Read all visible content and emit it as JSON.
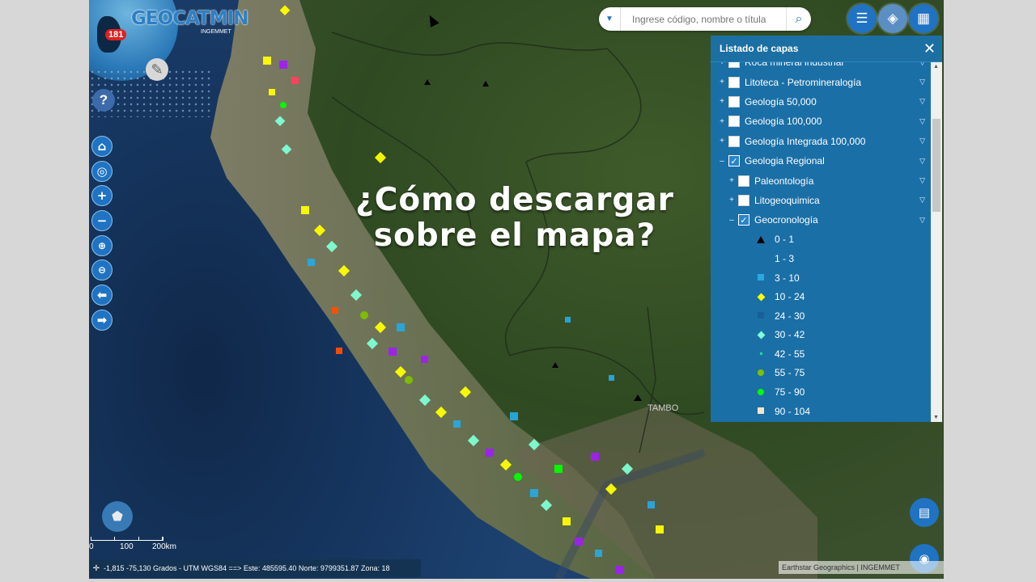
{
  "logo": {
    "text": "GEOCATMIN",
    "sub": "INGEMMET",
    "badge": "181"
  },
  "search": {
    "placeholder": "Ingrese código, nombre o títula"
  },
  "overlay": {
    "line1": "¿Cómo descargar",
    "line2": "sobre el mapa?"
  },
  "layers_panel": {
    "title": "Listado de capas",
    "close_icon": "close-icon",
    "rows": [
      {
        "label": "Roca mineral industrial",
        "expand": "+",
        "checked": false,
        "indent": 0
      },
      {
        "label": "Litoteca - Petromineralogía",
        "expand": "+",
        "checked": false,
        "indent": 0
      },
      {
        "label": "Geología 50,000",
        "expand": "+",
        "checked": false,
        "indent": 0
      },
      {
        "label": "Geología 100,000",
        "expand": "+",
        "checked": false,
        "indent": 0
      },
      {
        "label": "Geología Integrada 100,000",
        "expand": "+",
        "checked": false,
        "indent": 0
      },
      {
        "label": "Geologia Regional",
        "expand": "–",
        "checked": true,
        "indent": 0
      },
      {
        "label": "Paleontología",
        "expand": "+",
        "checked": false,
        "indent": 1
      },
      {
        "label": "Litogeoquimica",
        "expand": "+",
        "checked": false,
        "indent": 1
      },
      {
        "label": "Geocronología",
        "expand": "–",
        "checked": true,
        "indent": 1
      }
    ],
    "legend": [
      {
        "label": "0 - 1",
        "symbol": "triangle",
        "color": "#000000"
      },
      {
        "label": "1 - 3",
        "symbol": "none",
        "color": "#1a6fa7"
      },
      {
        "label": "3 - 10",
        "symbol": "square",
        "color": "#29a8e0"
      },
      {
        "label": "10 - 24",
        "symbol": "diamond",
        "color": "#ffff00"
      },
      {
        "label": "24 - 30",
        "symbol": "square",
        "color": "#1a5f98"
      },
      {
        "label": "30 - 42",
        "symbol": "diamond",
        "color": "#7fffd4"
      },
      {
        "label": "42 - 55",
        "symbol": "dot",
        "color": "#2ad3a0"
      },
      {
        "label": "55 - 75",
        "symbol": "circle",
        "color": "#80c000"
      },
      {
        "label": "75 - 90",
        "symbol": "circle",
        "color": "#00ff00"
      },
      {
        "label": "90 - 104",
        "symbol": "square",
        "color": "#f5e6c8"
      }
    ]
  },
  "statusbar": {
    "coords": "-1,815 -75,130 Grados - UTM WGS84 ==> Este: 485595.40 Norte: 9799351.87 Zona: 18"
  },
  "attribution": "Earthstar Geographics | INGEMMET",
  "scale": {
    "l0": "0",
    "l1": "100",
    "l2": "200km"
  },
  "map_labels": {
    "tambo": "TAMBO"
  },
  "icons": {
    "home": "home-icon",
    "locate": "crosshair-icon",
    "zoom_in": "plus-icon",
    "zoom_out": "minus-icon",
    "zoom_in_box": "magnify-plus-icon",
    "zoom_out_box": "magnify-minus-icon",
    "back": "arrow-left-icon",
    "forward": "arrow-right-icon",
    "list": "list-icon",
    "layers": "layers-icon",
    "grid": "grid-icon",
    "table": "table-icon",
    "eye": "eye-icon"
  }
}
